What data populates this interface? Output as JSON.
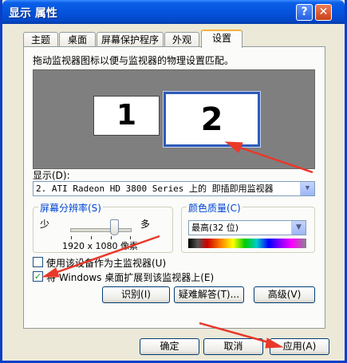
{
  "window": {
    "title": "显示 属性",
    "help_glyph": "?",
    "close_glyph": "✕"
  },
  "tabs": [
    {
      "label": "主题"
    },
    {
      "label": "桌面"
    },
    {
      "label": "屏幕保护程序"
    },
    {
      "label": "外观"
    },
    {
      "label": "设置",
      "active": true
    }
  ],
  "settings": {
    "instruction": "拖动监视器图标以便与监视器的物理设置匹配。",
    "monitors": [
      {
        "label": "1"
      },
      {
        "label": "2",
        "selected": true
      }
    ],
    "display_label": "显示(D):",
    "display_value": "2. ATI Radeon HD 3800 Series  上的 即插即用监视器",
    "resolution": {
      "legend": "屏幕分辨率(S)",
      "min_label": "少",
      "max_label": "多",
      "value": "1920 x 1080 像素",
      "slider_position": 0.75
    },
    "color_quality": {
      "legend": "颜色质量(C)",
      "value": "最高(32 位)"
    },
    "primary_checkbox": {
      "label": "使用该设备作为主监视器(U)",
      "checked": false
    },
    "extend_checkbox": {
      "label": "将 Windows 桌面扩展到该监视器上(E)",
      "checked": true
    },
    "buttons": {
      "identify": "识别(I)",
      "troubleshoot": "疑难解答(T)...",
      "advanced": "高级(V)"
    }
  },
  "footer": {
    "ok": "确定",
    "cancel": "取消",
    "apply": "应用(A)"
  },
  "colors": {
    "accent_blue": "#0553dd",
    "arrow_red": "#e8382a",
    "group_label": "#0046d5"
  },
  "icons": {
    "dropdown": "chevron-down-icon",
    "check": "checkmark-icon"
  }
}
